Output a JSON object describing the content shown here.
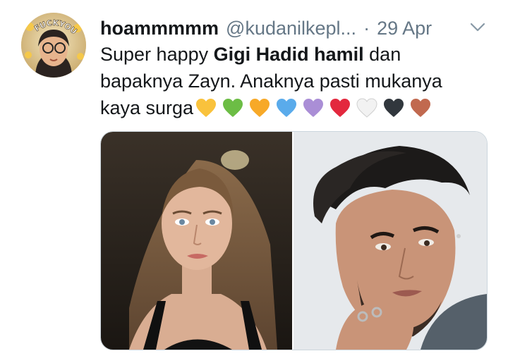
{
  "tweet": {
    "display_name": "hoammmmm",
    "handle": "@kudanilkepl...",
    "separator": "·",
    "date": "29 Apr",
    "text_part1": "Super happy ",
    "text_bold": "Gigi Hadid hamil",
    "text_part2": " dan bapaknya Zayn. Anaknya pasti mukanya kaya surga",
    "avatar_text": "FUCKYOU",
    "emoji_hearts": [
      {
        "name": "yellow-heart-icon",
        "color": "#f9c23c"
      },
      {
        "name": "green-heart-icon",
        "color": "#6cbd45"
      },
      {
        "name": "orange-heart-icon",
        "color": "#f7a928"
      },
      {
        "name": "blue-heart-icon",
        "color": "#5aabeb"
      },
      {
        "name": "purple-heart-icon",
        "color": "#aa8ed6"
      },
      {
        "name": "red-heart-icon",
        "color": "#e3283e"
      },
      {
        "name": "white-heart-icon",
        "color": "#f2f2f2"
      },
      {
        "name": "black-heart-icon",
        "color": "#31373d"
      },
      {
        "name": "brown-heart-icon",
        "color": "#c1694f"
      }
    ]
  },
  "colors": {
    "text": "#14171a",
    "muted": "#657786",
    "border": "#ccd6dd"
  }
}
